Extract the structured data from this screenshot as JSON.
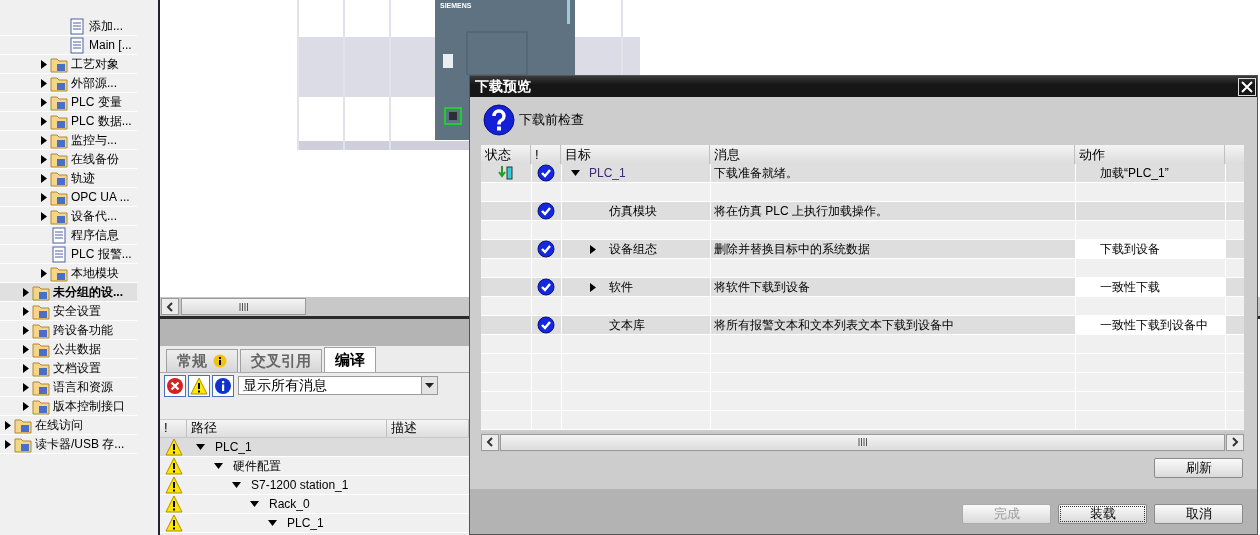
{
  "tree": [
    {
      "children": [
        {
          "children": [
            {
              "children": [
                {
                  "label": "添加...",
                  "selected": false
                },
                {
                  "label": "Main [...",
                  "selected": false
                }
              ]
            },
            {
              "label": "工艺对象",
              "expanded": false,
              "selected": false
            },
            {
              "label": "外部源...",
              "expanded": false,
              "selected": false
            },
            {
              "label": "PLC 变量",
              "expanded": false,
              "selected": false
            },
            {
              "label": "PLC 数据...",
              "expanded": false,
              "selected": false
            },
            {
              "label": "监控与...",
              "expanded": false,
              "selected": false
            },
            {
              "label": "在线备份",
              "expanded": false,
              "selected": false
            },
            {
              "label": "轨迹",
              "expanded": false,
              "selected": false
            },
            {
              "label": "OPC UA ...",
              "expanded": false,
              "selected": false
            },
            {
              "label": "设备代...",
              "expanded": false,
              "selected": false
            },
            {
              "label": "程序信息",
              "selected": false
            },
            {
              "label": "PLC 报警...",
              "selected": false
            },
            {
              "label": "本地模块",
              "expanded": false,
              "selected": false
            }
          ]
        },
        {
          "label": "未分组的设...",
          "expanded": false,
          "selected": true
        },
        {
          "label": "安全设置",
          "expanded": false,
          "selected": false
        },
        {
          "label": "跨设备功能",
          "expanded": false,
          "selected": false
        },
        {
          "label": "公共数据",
          "expanded": false,
          "selected": false
        },
        {
          "label": "文档设置",
          "expanded": false,
          "selected": false
        },
        {
          "label": "语言和资源",
          "expanded": false,
          "selected": false
        },
        {
          "label": "版本控制接口",
          "expanded": false,
          "selected": false
        }
      ]
    },
    {
      "label": "在线访问",
      "expanded": false,
      "selected": false
    },
    {
      "label": "读卡器/USB 存...",
      "expanded": false,
      "selected": false
    }
  ],
  "canvas": {
    "module_label": "SIEMENS"
  },
  "inspector": {
    "tabs": [
      {
        "label": "常规",
        "selected": false,
        "kind": "info"
      },
      {
        "label": "交叉引用",
        "selected": false,
        "kind": "plain"
      },
      {
        "label": "编译",
        "selected": true,
        "kind": "plain"
      }
    ],
    "filters": [
      {
        "kind": "error"
      },
      {
        "kind": "warning"
      },
      {
        "kind": "info"
      }
    ],
    "filter_value": "显示所有消息",
    "columns": [
      "!",
      "路径",
      "描述"
    ],
    "messages": [
      {
        "kind": "warning",
        "label": "PLC_1",
        "selected": true,
        "expanded": true,
        "children": [
          {
            "kind": "warning",
            "label": "硬件配置",
            "selected": false,
            "expanded": true,
            "children": [
              {
                "kind": "warning",
                "label": "S7-1200 station_1",
                "selected": false,
                "expanded": true,
                "children": [
                  {
                    "kind": "warning",
                    "label": "Rack_0",
                    "selected": false,
                    "expanded": true,
                    "children": [
                      {
                        "kind": "warning",
                        "label": "PLC_1",
                        "selected": false,
                        "expanded": true
                      }
                    ]
                  }
                ]
              }
            ]
          }
        ]
      }
    ]
  },
  "dialog": {
    "title": "下载预览",
    "heading": "下载前检查",
    "columns": [
      "状态",
      "!",
      "目标",
      "消息",
      "动作"
    ],
    "rows": [
      {
        "kind": "device",
        "ok": true,
        "target": "PLC_1",
        "expanded": true,
        "message": "下载准备就绪。",
        "action": {
          "text": "加载“PLC_1”",
          "kind": "plain"
        },
        "children": [
          {
            "ok": true,
            "target": "仿真模块",
            "message": "将在仿真 PLC 上执行加载操作。"
          },
          {
            "ok": true,
            "target": "设备组态",
            "expanded": false,
            "message": "删除并替换目标中的系统数据",
            "action": {
              "text": "下载到设备",
              "kind": "choice"
            }
          },
          {
            "ok": true,
            "target": "软件",
            "expanded": false,
            "message": "将软件下载到设备",
            "action": {
              "text": "一致性下载",
              "kind": "choice"
            }
          },
          {
            "ok": true,
            "target": "文本库",
            "message": "将所有报警文本和文本列表文本下载到设备中",
            "action": {
              "text": "一致性下载到设备中",
              "kind": "choice"
            }
          }
        ]
      }
    ],
    "refresh": "刷新",
    "buttons": [
      {
        "label": "完成",
        "disabled": true,
        "focused": false
      },
      {
        "label": "装载",
        "disabled": false,
        "focused": true
      },
      {
        "label": "取消",
        "disabled": false,
        "focused": false
      }
    ]
  }
}
